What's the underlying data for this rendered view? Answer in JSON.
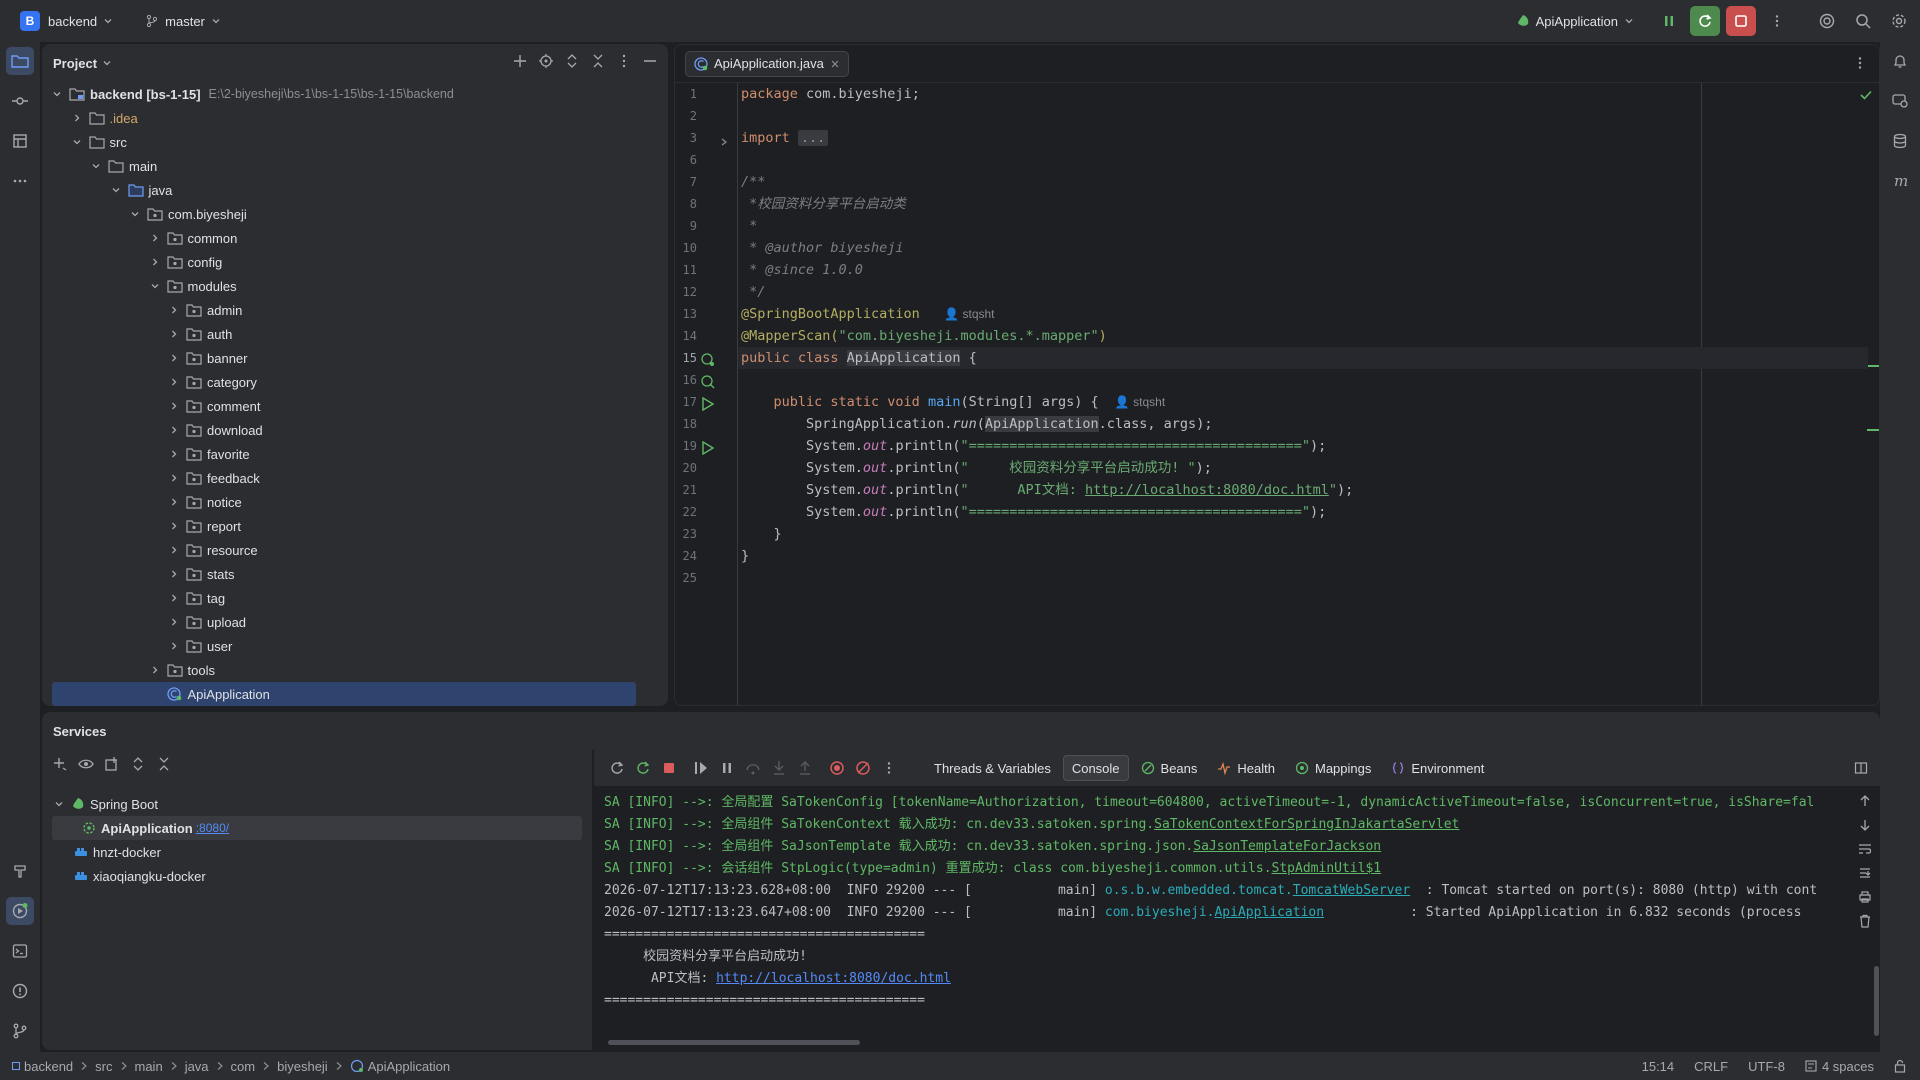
{
  "titlebar": {
    "project_badge": "B",
    "project_name": "backend",
    "branch": "master",
    "run_config": "ApiApplication"
  },
  "project_panel": {
    "title": "Project",
    "tree": [
      {
        "label": "backend [bs-1-15]",
        "extra": "E:\\2-biyesheji\\bs-1\\bs-1-15\\bs-1-15\\backend",
        "icon": "module-folder-icon",
        "depth": 0,
        "expanded": true
      },
      {
        "label": ".idea",
        "icon": "folder-icon",
        "depth": 1,
        "expanded": false,
        "style": "orange"
      },
      {
        "label": "src",
        "icon": "folder-icon",
        "depth": 1,
        "expanded": true
      },
      {
        "label": "main",
        "icon": "folder-icon",
        "depth": 2,
        "expanded": true
      },
      {
        "label": "java",
        "icon": "source-folder-icon",
        "depth": 3,
        "expanded": true
      },
      {
        "label": "com.biyesheji",
        "icon": "package-icon",
        "depth": 4,
        "expanded": true
      },
      {
        "label": "common",
        "icon": "package-icon",
        "depth": 5,
        "expanded": false
      },
      {
        "label": "config",
        "icon": "package-icon",
        "depth": 5,
        "expanded": false
      },
      {
        "label": "modules",
        "icon": "package-icon",
        "depth": 5,
        "expanded": true
      },
      {
        "label": "admin",
        "icon": "package-icon",
        "depth": 6,
        "expanded": false
      },
      {
        "label": "auth",
        "icon": "package-icon",
        "depth": 6,
        "expanded": false
      },
      {
        "label": "banner",
        "icon": "package-icon",
        "depth": 6,
        "expanded": false
      },
      {
        "label": "category",
        "icon": "package-icon",
        "depth": 6,
        "expanded": false
      },
      {
        "label": "comment",
        "icon": "package-icon",
        "depth": 6,
        "expanded": false
      },
      {
        "label": "download",
        "icon": "package-icon",
        "depth": 6,
        "expanded": false
      },
      {
        "label": "favorite",
        "icon": "package-icon",
        "depth": 6,
        "expanded": false
      },
      {
        "label": "feedback",
        "icon": "package-icon",
        "depth": 6,
        "expanded": false
      },
      {
        "label": "notice",
        "icon": "package-icon",
        "depth": 6,
        "expanded": false
      },
      {
        "label": "report",
        "icon": "package-icon",
        "depth": 6,
        "expanded": false
      },
      {
        "label": "resource",
        "icon": "package-icon",
        "depth": 6,
        "expanded": false
      },
      {
        "label": "stats",
        "icon": "package-icon",
        "depth": 6,
        "expanded": false
      },
      {
        "label": "tag",
        "icon": "package-icon",
        "depth": 6,
        "expanded": false
      },
      {
        "label": "upload",
        "icon": "package-icon",
        "depth": 6,
        "expanded": false
      },
      {
        "label": "user",
        "icon": "package-icon",
        "depth": 6,
        "expanded": false
      },
      {
        "label": "tools",
        "icon": "package-icon",
        "depth": 5,
        "expanded": false
      },
      {
        "label": "ApiApplication",
        "icon": "spring-class-icon",
        "depth": 5,
        "selected": true
      }
    ]
  },
  "editor": {
    "tab_label": "ApiApplication.java",
    "line_numbers": [
      "1",
      "2",
      "3",
      "6",
      "7",
      "8",
      "9",
      "10",
      "11",
      "12",
      "13",
      "14",
      "15",
      "16",
      "17",
      "18",
      "19",
      "20",
      "21",
      "22",
      "23",
      "24",
      "25"
    ],
    "current_line": "15",
    "code": {
      "l1_kw": "package",
      "l1_rest": " com.biyesheji;",
      "l3_kw": "import",
      "l3_fold": "...",
      "l7": "/**",
      "l8": " *校园资料分享平台启动类",
      "l9": " *",
      "l10_tag": " * @author",
      "l10_rest": " biyesheji",
      "l11_tag": " * @since",
      "l11_rest": " 1.0.0",
      "l12": " */",
      "l13_ann": "@SpringBootApplication",
      "l13_hint": "stqsht",
      "l14_ann": "@MapperScan(",
      "l14_str": "\"com.biyesheji.modules.*.mapper\"",
      "l14_end": ")",
      "l15_kw": "public class ",
      "l15_name": "ApiApplication",
      "l15_end": " {",
      "l17_kw": "    public static void ",
      "l17_fn": "main",
      "l17_rest": "(String[] args) {",
      "l17_hint": "stqsht",
      "l18_a": "        SpringApplication.",
      "l18_run": "run",
      "l18_b": "(",
      "l18_cls": "ApiApplication",
      "l18_c": ".class, args);",
      "sys": "        System.",
      "out": "out",
      "println": ".println(",
      "l19_str": "\"=========================================\"",
      "l20_str": "\"     校园资料分享平台启动成功! \"",
      "l21_str_a": "\"      API文档: ",
      "l21_link": "http://localhost:8080/doc.html",
      "l21_str_b": "\"",
      "l22_str": "\"=========================================\"",
      "close": ");",
      "l23": "    }",
      "l24": "}"
    }
  },
  "services": {
    "title": "Services",
    "tree": [
      {
        "label": "Spring Boot",
        "icon": "spring-boot-icon"
      },
      {
        "label": "ApiApplication",
        "port": ":8080/",
        "icon": "spring-run-icon"
      },
      {
        "label": "hnzt-docker",
        "icon": "docker-icon"
      },
      {
        "label": "xiaoqiangku-docker",
        "icon": "docker-icon"
      }
    ],
    "tabs": [
      "Threads & Variables",
      "Console",
      "Beans",
      "Health",
      "Mappings",
      "Environment"
    ],
    "active_tab": "Console",
    "console": {
      "l1": "SA [INFO] -->: 全局配置 SaTokenConfig [tokenName=Authorization, timeout=604800, activeTimeout=-1, dynamicActiveTimeout=false, isConcurrent=true, isShare=fal",
      "l2_a": "SA [INFO] -->: 全局组件 SaTokenContext 载入成功: cn.dev33.satoken.spring.",
      "l2_b": "SaTokenContextForSpringInJakartaServlet",
      "l3_a": "SA [INFO] -->: 全局组件 SaJsonTemplate 载入成功: cn.dev33.satoken.spring.json.",
      "l3_b": "SaJsonTemplateForJackson",
      "l4_a": "SA [INFO] -->: 会话组件 StpLogic(type=admin) 重置成功: class com.biyesheji.common.utils.",
      "l4_b": "StpAdminUtil$1",
      "l5_a": "2026-07-12T17:13:23.628+08:00  INFO 29200 --- [           main] ",
      "l5_b": "o.s.b.w.embedded.tomcat.",
      "l5_c": "TomcatWebServer",
      "l5_d": "  : Tomcat started on port(s): 8080 (http) with cont",
      "l6_a": "2026-07-12T17:13:23.647+08:00  INFO 29200 --- [           main] ",
      "l6_b": "com.biyesheji.",
      "l6_c": "ApiApplication",
      "l6_d": "           : Started ApiApplication in 6.832 seconds (process",
      "l7": "=========================================",
      "l8": "     校园资料分享平台启动成功!",
      "l9_a": "      API文档: ",
      "l9_link": "http://localhost:8080/doc.html",
      "l10": "========================================="
    }
  },
  "statusbar": {
    "breadcrumbs": [
      "backend",
      "src",
      "main",
      "java",
      "com",
      "biyesheji",
      "ApiApplication"
    ],
    "position": "15:14",
    "line_sep": "CRLF",
    "encoding": "UTF-8",
    "indent": "4 spaces"
  },
  "colors": {
    "accent": "#3574f0",
    "selection": "#2e436e",
    "run_green": "#5fb865",
    "stop_red": "#db5c5c"
  }
}
